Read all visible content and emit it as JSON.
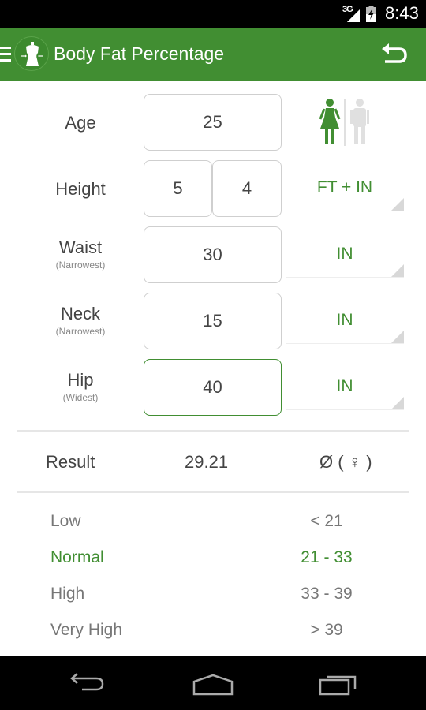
{
  "status_bar": {
    "network": "3G",
    "time": "8:43",
    "signal_icon": "cell-signal-icon",
    "battery_icon": "battery-charging-icon"
  },
  "action_bar": {
    "title": "Body Fat Percentage",
    "menu_icon": "hamburger-menu-icon",
    "logo_icon": "dress-form-icon",
    "undo_icon": "undo-icon"
  },
  "form": {
    "age": {
      "label": "Age",
      "value": "25"
    },
    "gender": {
      "selected": "female",
      "options": [
        "female",
        "male"
      ]
    },
    "height": {
      "label": "Height",
      "feet": "5",
      "inches": "4",
      "unit": "FT + IN"
    },
    "waist": {
      "label": "Waist",
      "sublabel": "(Narrowest)",
      "value": "30",
      "unit": "IN"
    },
    "neck": {
      "label": "Neck",
      "sublabel": "(Narrowest)",
      "value": "15",
      "unit": "IN"
    },
    "hip": {
      "label": "Hip",
      "sublabel": "(Widest)",
      "value": "40",
      "unit": "IN"
    }
  },
  "result": {
    "label": "Result",
    "value": "29.21",
    "classification": "Ø ( ♀ )"
  },
  "ranges": [
    {
      "name": "Low",
      "range": "< 21",
      "active": false
    },
    {
      "name": "Normal",
      "range": "21 - 33",
      "active": true
    },
    {
      "name": "High",
      "range": "33 - 39",
      "active": false
    },
    {
      "name": "Very High",
      "range": "> 39",
      "active": false
    }
  ],
  "colors": {
    "accent": "#418e32",
    "inactive_gender": "#e0e0e0",
    "text": "#444444",
    "muted": "#777777"
  },
  "nav_bar": {
    "back_icon": "back-icon",
    "home_icon": "home-icon",
    "recents_icon": "recent-apps-icon"
  }
}
